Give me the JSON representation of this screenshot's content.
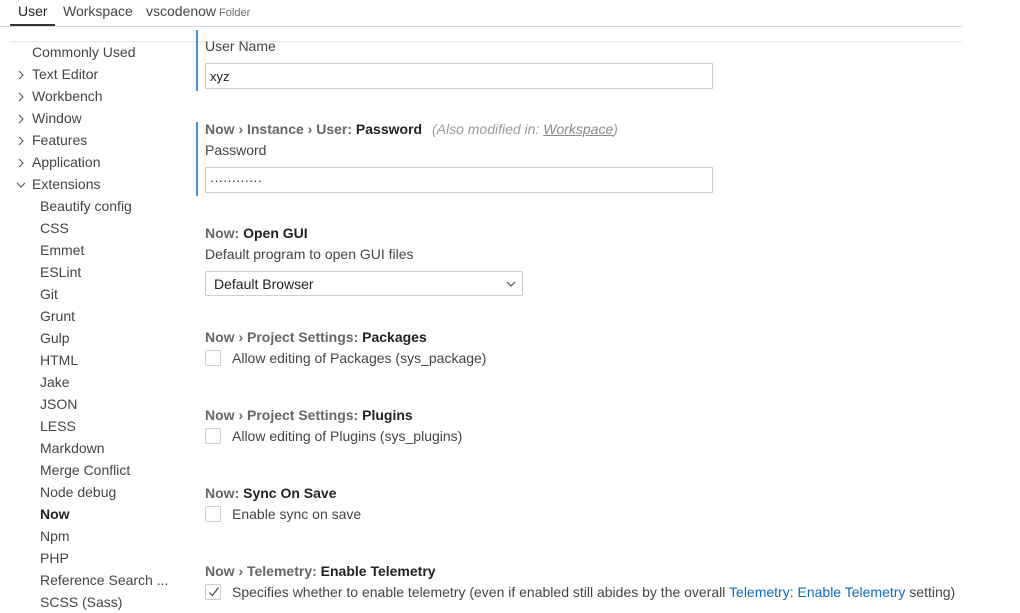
{
  "tabs": [
    {
      "label": "User"
    },
    {
      "label": "Workspace"
    },
    {
      "label": "vscodenow",
      "tag": "Folder"
    }
  ],
  "toc": {
    "items": [
      {
        "label": "Commonly Used"
      },
      {
        "label": "Text Editor"
      },
      {
        "label": "Workbench"
      },
      {
        "label": "Window"
      },
      {
        "label": "Features"
      },
      {
        "label": "Application"
      },
      {
        "label": "Extensions"
      }
    ],
    "extensions": [
      {
        "label": "Beautify config"
      },
      {
        "label": "CSS"
      },
      {
        "label": "Emmet"
      },
      {
        "label": "ESLint"
      },
      {
        "label": "Git"
      },
      {
        "label": "Grunt"
      },
      {
        "label": "Gulp"
      },
      {
        "label": "HTML"
      },
      {
        "label": "Jake"
      },
      {
        "label": "JSON"
      },
      {
        "label": "LESS"
      },
      {
        "label": "Markdown"
      },
      {
        "label": "Merge Conflict"
      },
      {
        "label": "Node debug"
      },
      {
        "label": "Now"
      },
      {
        "label": "Npm"
      },
      {
        "label": "PHP"
      },
      {
        "label": "Reference Search ..."
      },
      {
        "label": "SCSS (Sass)"
      }
    ]
  },
  "settings": {
    "username": {
      "description": "User Name",
      "value": "xyz"
    },
    "password": {
      "category": "Now › Instance › User: ",
      "key": "Password",
      "also_prefix": "(Also modified in: ",
      "also_link": "Workspace",
      "also_suffix": ")",
      "description": "Password",
      "value": "············"
    },
    "open_gui": {
      "category": "Now: ",
      "key": "Open GUI",
      "description": "Default program to open GUI files",
      "selected": "Default Browser"
    },
    "packages": {
      "category": "Now › Project Settings: ",
      "key": "Packages",
      "label": "Allow editing of Packages (sys_package)",
      "checked": false
    },
    "plugins": {
      "category": "Now › Project Settings: ",
      "key": "Plugins",
      "label": "Allow editing of Plugins (sys_plugins)",
      "checked": false
    },
    "sync_on_save": {
      "category": "Now: ",
      "key": "Sync On Save",
      "label": "Enable sync on save",
      "checked": false
    },
    "telemetry": {
      "category": "Now › Telemetry: ",
      "key": "Enable Telemetry",
      "label_before": "Specifies whether to enable telemetry (even if enabled still abides by the overall ",
      "link": "Telemetry: Enable Telemetry",
      "label_after": " setting)",
      "checked": true
    }
  },
  "colors": {
    "modified_indicator": "#3a96dd",
    "link": "#0b6bc4"
  },
  "icons": {
    "collapsed": "chevron-right-icon",
    "expanded": "chevron-down-icon",
    "select": "chevron-down-icon",
    "checked": "check-icon"
  }
}
